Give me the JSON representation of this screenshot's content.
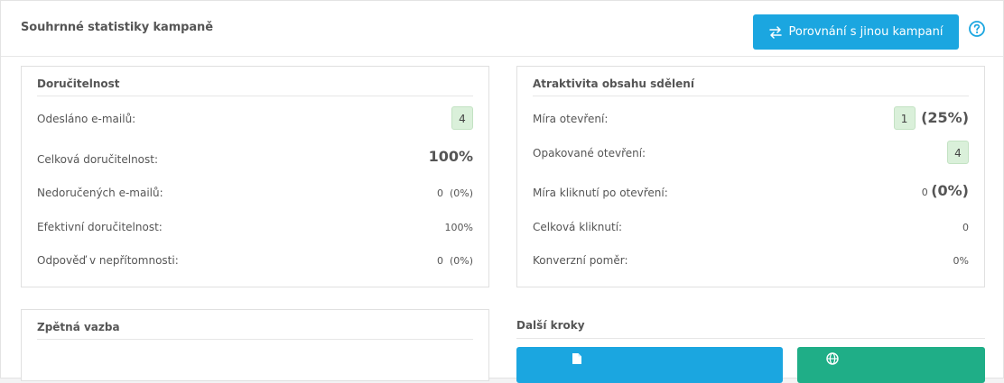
{
  "header": {
    "title": "Souhrnné statistiky kampaně",
    "compare_label": "Porovnání s jinou kampaní"
  },
  "deliverability": {
    "title": "Doručitelnost",
    "rows": [
      {
        "label": "Odesláno e-mailů:",
        "value": "4"
      },
      {
        "label": "Celková doručitelnost:",
        "value": "100%"
      },
      {
        "label": "Nedoručených e-mailů:",
        "value": "0",
        "pct": "(0%)"
      },
      {
        "label": "Efektivní doručitelnost:",
        "value": "100%"
      },
      {
        "label": "Odpověď v nepřítomnosti:",
        "value": "0",
        "pct": "(0%)"
      }
    ]
  },
  "attractiveness": {
    "title": "Atraktivita obsahu sdělení",
    "rows": [
      {
        "label": "Míra otevření:",
        "value": "1",
        "pct": "(25%)"
      },
      {
        "label": "Opakované otevření:",
        "value": "4"
      },
      {
        "label": "Míra kliknutí po otevření:",
        "value": "0",
        "pct": "(0%)"
      },
      {
        "label": "Celková kliknutí:",
        "value": "0"
      },
      {
        "label": "Konverzní poměr:",
        "value": "0%"
      }
    ]
  },
  "feedback": {
    "title": "Zpětná vazba"
  },
  "next_steps": {
    "title": "Další kroky"
  },
  "colors": {
    "accent": "#1ba6e0",
    "green": "#1fae87",
    "badge": "#daf0da"
  },
  "icons": {
    "compare": "swap-arrows-icon",
    "help": "question-circle-icon",
    "doc": "document-icon",
    "globe": "globe-icon"
  }
}
